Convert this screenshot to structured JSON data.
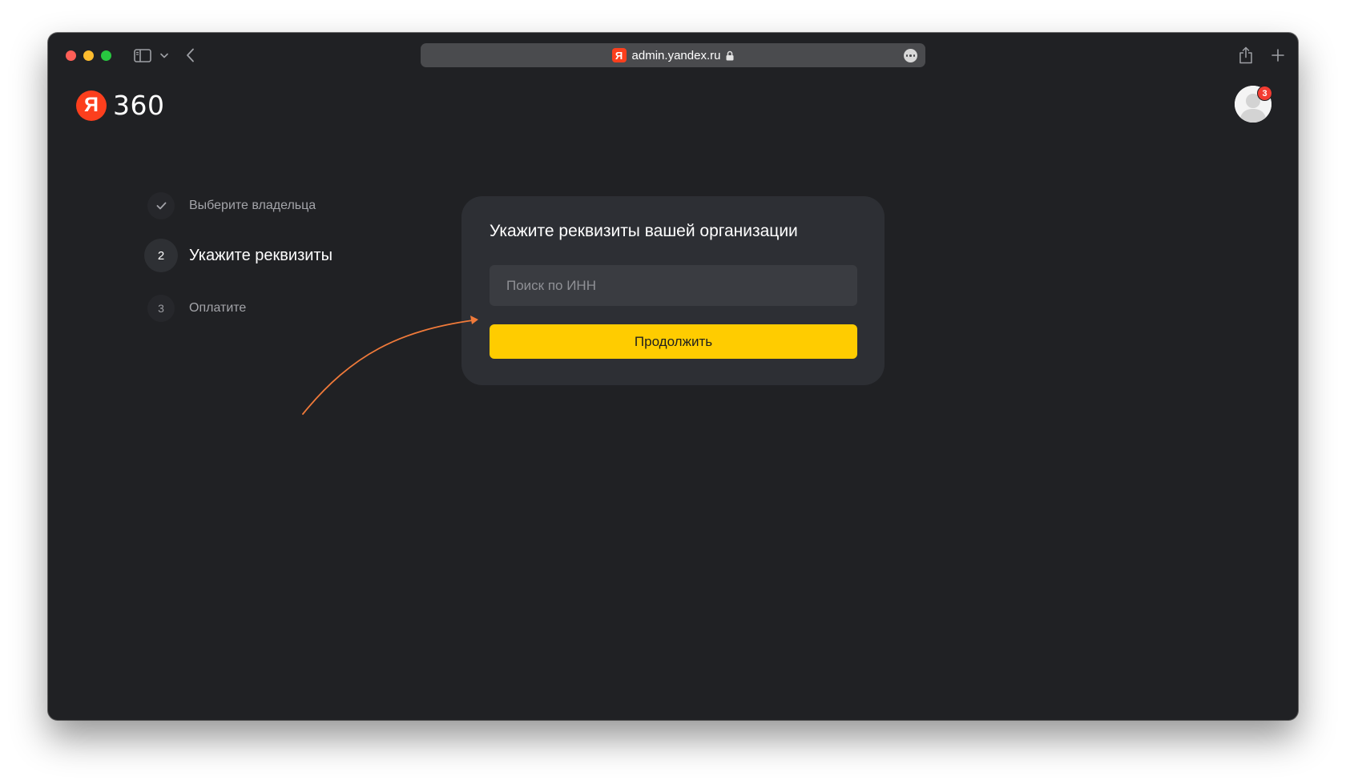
{
  "browser": {
    "url": "admin.yandex.ru",
    "favicon_letter": "Я",
    "icons": [
      "sidebar-icon",
      "chevron-down-icon",
      "back-icon",
      "lock-icon",
      "more-icon",
      "share-icon",
      "plus-icon"
    ]
  },
  "header": {
    "logo_letter": "Я",
    "logo_text": "360",
    "brand_color": "#fc3f1d",
    "notification_count": "3"
  },
  "steps": [
    {
      "marker": "",
      "label": "Выберите владельца",
      "state": "done"
    },
    {
      "marker": "2",
      "label": "Укажите реквизиты",
      "state": "current"
    },
    {
      "marker": "3",
      "label": "Оплатите",
      "state": "upcoming"
    }
  ],
  "card": {
    "title": "Укажите реквизиты вашей организации",
    "inn_input": {
      "value": "",
      "placeholder": "Поиск по ИНН"
    },
    "continue_label": "Продолжить",
    "button_color": "#ffcc00"
  },
  "annotation": {
    "arrow_color": "#f07a3a"
  }
}
